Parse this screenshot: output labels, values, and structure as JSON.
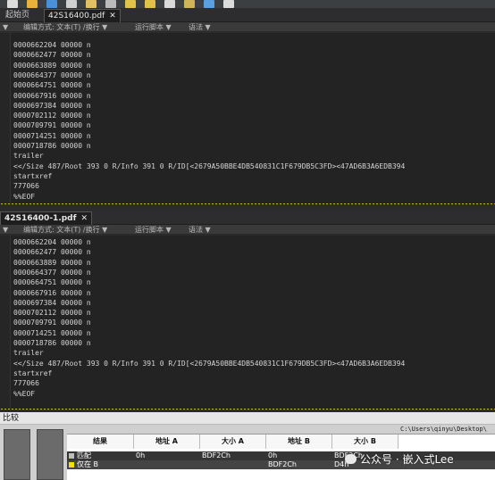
{
  "tabs_top": {
    "start_page": "起始页",
    "file": "42S16400.pdf"
  },
  "tabs_bottom": {
    "file": "42S16400-1.pdf"
  },
  "statusbar": {
    "arrow": "▼",
    "edit_mode": "编辑方式: 文本(T) /换行 ▼",
    "script": "运行脚本 ▼",
    "syntax": "语法 ▼"
  },
  "code_top": [
    "0000662204 00000 n",
    "0000662477 00000 n",
    "0000663889 00000 n",
    "0000664377 00000 n",
    "0000664751 00000 n",
    "0000667916 00000 n",
    "0000697384 00000 n",
    "0000702112 00000 n",
    "0000709791 00000 n",
    "0000714251 00000 n",
    "0000718786 00000 n",
    "trailer",
    "<</Size 487/Root 393 0 R/Info 391 0 R/ID[<2679A50BBE4DB540831C1F679DB5C3FD><47AD6B3A6EDB394",
    "startxref",
    "777066",
    "%%EOF"
  ],
  "code_bottom": [
    "0000662204 00000 n",
    "0000662477 00000 n",
    "0000663889 00000 n",
    "0000664377 00000 n",
    "0000664751 00000 n",
    "0000667916 00000 n",
    "0000697384 00000 n",
    "0000702112 00000 n",
    "0000709791 00000 n",
    "0000714251 00000 n",
    "0000718786 00000 n",
    "trailer",
    "<</Size 487/Root 393 0 R/Info 391 0 R/ID[<2679A50BBE4DB540831C1F679DB5C3FD><47AD6B3A6EDB394",
    "startxref",
    "777066",
    "%%EOF"
  ],
  "compare": {
    "title": "比较",
    "path": "C:\\Users\\qinyu\\Desktop\\",
    "headers": [
      "结果",
      "地址 A",
      "大小 A",
      "地址 B",
      "大小 B"
    ],
    "rows": [
      {
        "result": "匹配",
        "addr_a": "0h",
        "size_a": "BDF2Ch",
        "addr_b": "0h",
        "size_b": "BDF2Ch",
        "color": "#bdbdbd"
      },
      {
        "result": "仅在 B",
        "addr_a": "",
        "size_a": "",
        "addr_b": "BDF2Ch",
        "size_b": "D4h",
        "color": "#f5e000"
      }
    ]
  },
  "watermark": "公众号 · 嵌入式Lee",
  "colors": {
    "editor_bg": "#232323",
    "match_marker": "#bdbdbd",
    "only_b_marker": "#f5e000"
  }
}
